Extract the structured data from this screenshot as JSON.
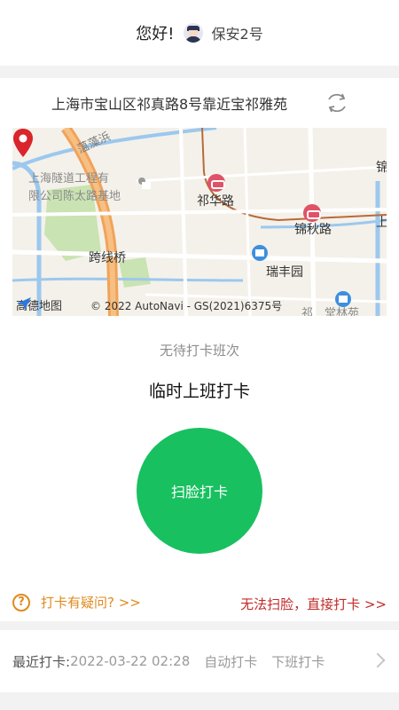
{
  "header": {
    "greeting": "您好!",
    "user": "保安2号"
  },
  "location": {
    "address": "上海市宝山区祁真路8号靠近宝祁雅苑",
    "refresh_icon": "refresh-icon"
  },
  "map": {
    "labels": {
      "river": "蕰藻浜",
      "company_line1": "上海隧道工程有",
      "company_line2": "限公司陈太路基地",
      "station1": "祁华路",
      "station2": "锦秋路",
      "bridge": "跨线桥",
      "community": "瑞丰园",
      "right_top": "锦",
      "right_mid": "上",
      "bottom_right": "祁",
      "bottom_right2": "堂林苑"
    },
    "brand": "高德地图",
    "copyright": "© 2022 AutoNavi - GS(2021)6375号"
  },
  "checkin": {
    "status": "无待打卡班次",
    "title": "临时上班打卡",
    "scan_button": "扫脸打卡"
  },
  "links": {
    "help": "打卡有疑问? >>",
    "direct": "无法扫脸，直接打卡 >>"
  },
  "recent": {
    "label": "最近打卡:",
    "time": "2022-03-22 02:28",
    "mode": "自动打卡",
    "kind": "下班打卡"
  },
  "colors": {
    "accent_green": "#18c060",
    "help_orange": "#e08a1e",
    "direct_red": "#c22b2b"
  }
}
